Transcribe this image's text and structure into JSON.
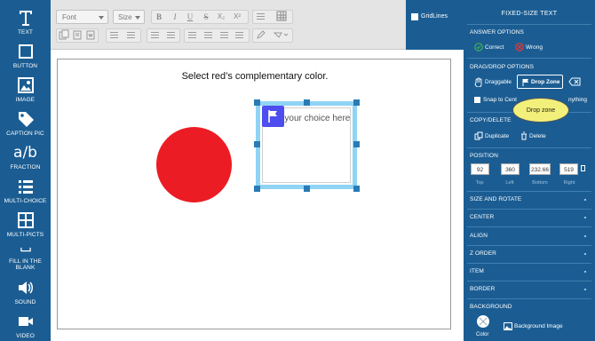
{
  "sidebar": {
    "tools": [
      {
        "label": "TEXT",
        "icon": "text-icon"
      },
      {
        "label": "BUTTON",
        "icon": "button-icon"
      },
      {
        "label": "IMAGE",
        "icon": "image-icon"
      },
      {
        "label": "CAPTION PIC",
        "icon": "tag-icon"
      },
      {
        "label": "FRACTION",
        "icon": "fraction-icon"
      },
      {
        "label": "MULTI-CHOICE",
        "icon": "list-icon"
      },
      {
        "label": "MULTI-PICTS",
        "icon": "pictures-icon"
      },
      {
        "label": "FILL IN THE BLANK",
        "icon": "blank-icon"
      },
      {
        "label": "SOUND",
        "icon": "sound-icon"
      },
      {
        "label": "VIDEO",
        "icon": "video-icon"
      }
    ],
    "fraction_glyph": "a/b"
  },
  "toolbar": {
    "font_placeholder": "Font",
    "size_placeholder": "Size",
    "bold": "B",
    "italic": "I",
    "underline": "U",
    "strike": "S",
    "subscript": "X₂",
    "superscript": "X²"
  },
  "gridlines": {
    "label": "GridLines",
    "checked": false
  },
  "canvas": {
    "question": "Select red’s complementary color.",
    "dropzone_placeholder": "drag your choice here",
    "circle_color": "#ec1c24"
  },
  "panel": {
    "title": "FIXED-SIZE TEXT",
    "answer_options": {
      "heading": "ANSWER OPTIONS",
      "correct": "Correct",
      "wrong": "Wrong"
    },
    "dragdrop": {
      "heading": "DRAG/DROP OPTIONS",
      "draggable": "Draggable",
      "dropzone": "Drop Zone",
      "snap": "Snap to Cent",
      "anything": "nything"
    },
    "copydelete": {
      "heading": "COPY/DELETE",
      "duplicate": "Duplicate",
      "delete": "Delete"
    },
    "position": {
      "heading": "POSITION",
      "top": "92",
      "left": "360",
      "bottom": "232.66",
      "right": "519",
      "top_label": "Top",
      "left_label": "Left",
      "bottom_label": "Bottom",
      "right_label": "Right"
    },
    "sections": [
      "SIZE AND ROTATE",
      "CENTER",
      "ALIGN",
      "Z ORDER",
      "ITEM",
      "BORDER"
    ],
    "background": {
      "heading": "BACKGROUND",
      "color": "Color",
      "image": "Background Image"
    }
  },
  "tooltip": "Drop zone",
  "colors": {
    "panel": "#1b5d93",
    "dropzone_border": "#8fd3f5",
    "flag": "#4d4df0",
    "correct": "#3fb24a",
    "wrong": "#e23b3b"
  }
}
